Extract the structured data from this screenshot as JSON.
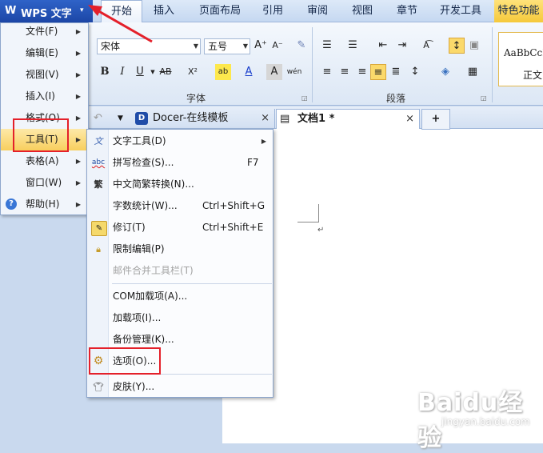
{
  "app": {
    "logo": "W",
    "name": "WPS 文字",
    "dropdown": "▾"
  },
  "ribbon_tabs": [
    "开始",
    "插入",
    "页面布局",
    "引用",
    "审阅",
    "视图",
    "章节",
    "开发工具",
    "特色功能"
  ],
  "ribbon": {
    "font_name": "宋体",
    "font_size": "五号",
    "font_group_label": "字体",
    "paragraph_group_label": "段落",
    "style_preview": "AaBbCcI",
    "style_name": "正文",
    "buttons": {
      "bold": "B",
      "italic": "I",
      "underline": "U",
      "strikethrough": "AB",
      "superscript": "X²",
      "grow": "A⁺",
      "shrink": "A⁻",
      "font_color": "A",
      "highlight": "ab",
      "char_shade": "A",
      "phonetic": "wén"
    }
  },
  "doc_tabs": [
    {
      "label": "Docer-在线模板",
      "close": "×"
    },
    {
      "label": "文档1 *",
      "close": "×"
    }
  ],
  "doc_tab_add": "+",
  "main_menu": [
    {
      "label": "文件(F)",
      "has_sub": true
    },
    {
      "label": "编辑(E)",
      "has_sub": true
    },
    {
      "label": "视图(V)",
      "has_sub": true
    },
    {
      "label": "插入(I)",
      "has_sub": true
    },
    {
      "label": "格式(O)",
      "has_sub": true
    },
    {
      "label": "工具(T)",
      "has_sub": true
    },
    {
      "label": "表格(A)",
      "has_sub": true
    },
    {
      "label": "窗口(W)",
      "has_sub": true
    },
    {
      "label": "帮助(H)",
      "has_sub": true
    }
  ],
  "tools_menu": [
    {
      "label": "文字工具(D)",
      "shortcut": "",
      "icon": "text-tool-icon"
    },
    {
      "label": "拼写检查(S)...",
      "shortcut": "F7",
      "icon": "spell-check-icon"
    },
    {
      "label": "中文简繁转换(N)...",
      "shortcut": "",
      "icon": "convert-icon"
    },
    {
      "label": "字数统计(W)...",
      "shortcut": "Ctrl+Shift+G",
      "icon": ""
    },
    {
      "label": "修订(T)",
      "shortcut": "Ctrl+Shift+E",
      "icon": "revision-icon"
    },
    {
      "label": "限制编辑(P)",
      "shortcut": "",
      "icon": "restrict-edit-icon"
    },
    {
      "label": "邮件合并工具栏(T)",
      "shortcut": "",
      "icon": ""
    },
    {
      "label": "COM加载项(A)...",
      "shortcut": "",
      "icon": ""
    },
    {
      "label": "加载项(I)...",
      "shortcut": "",
      "icon": ""
    },
    {
      "label": "备份管理(K)...",
      "shortcut": "",
      "icon": ""
    },
    {
      "label": "选项(O)...",
      "shortcut": "",
      "icon": "gear-icon"
    },
    {
      "label": "皮肤(Y)...",
      "shortcut": "",
      "icon": "shirt-icon"
    }
  ],
  "watermark": {
    "main": "Baidu经验",
    "sub": "jingyan.baidu.com"
  },
  "colors": {
    "highlight_box": "#e4202a",
    "menu_active": "#f8cf5e",
    "app_button": "#1c46a6"
  }
}
